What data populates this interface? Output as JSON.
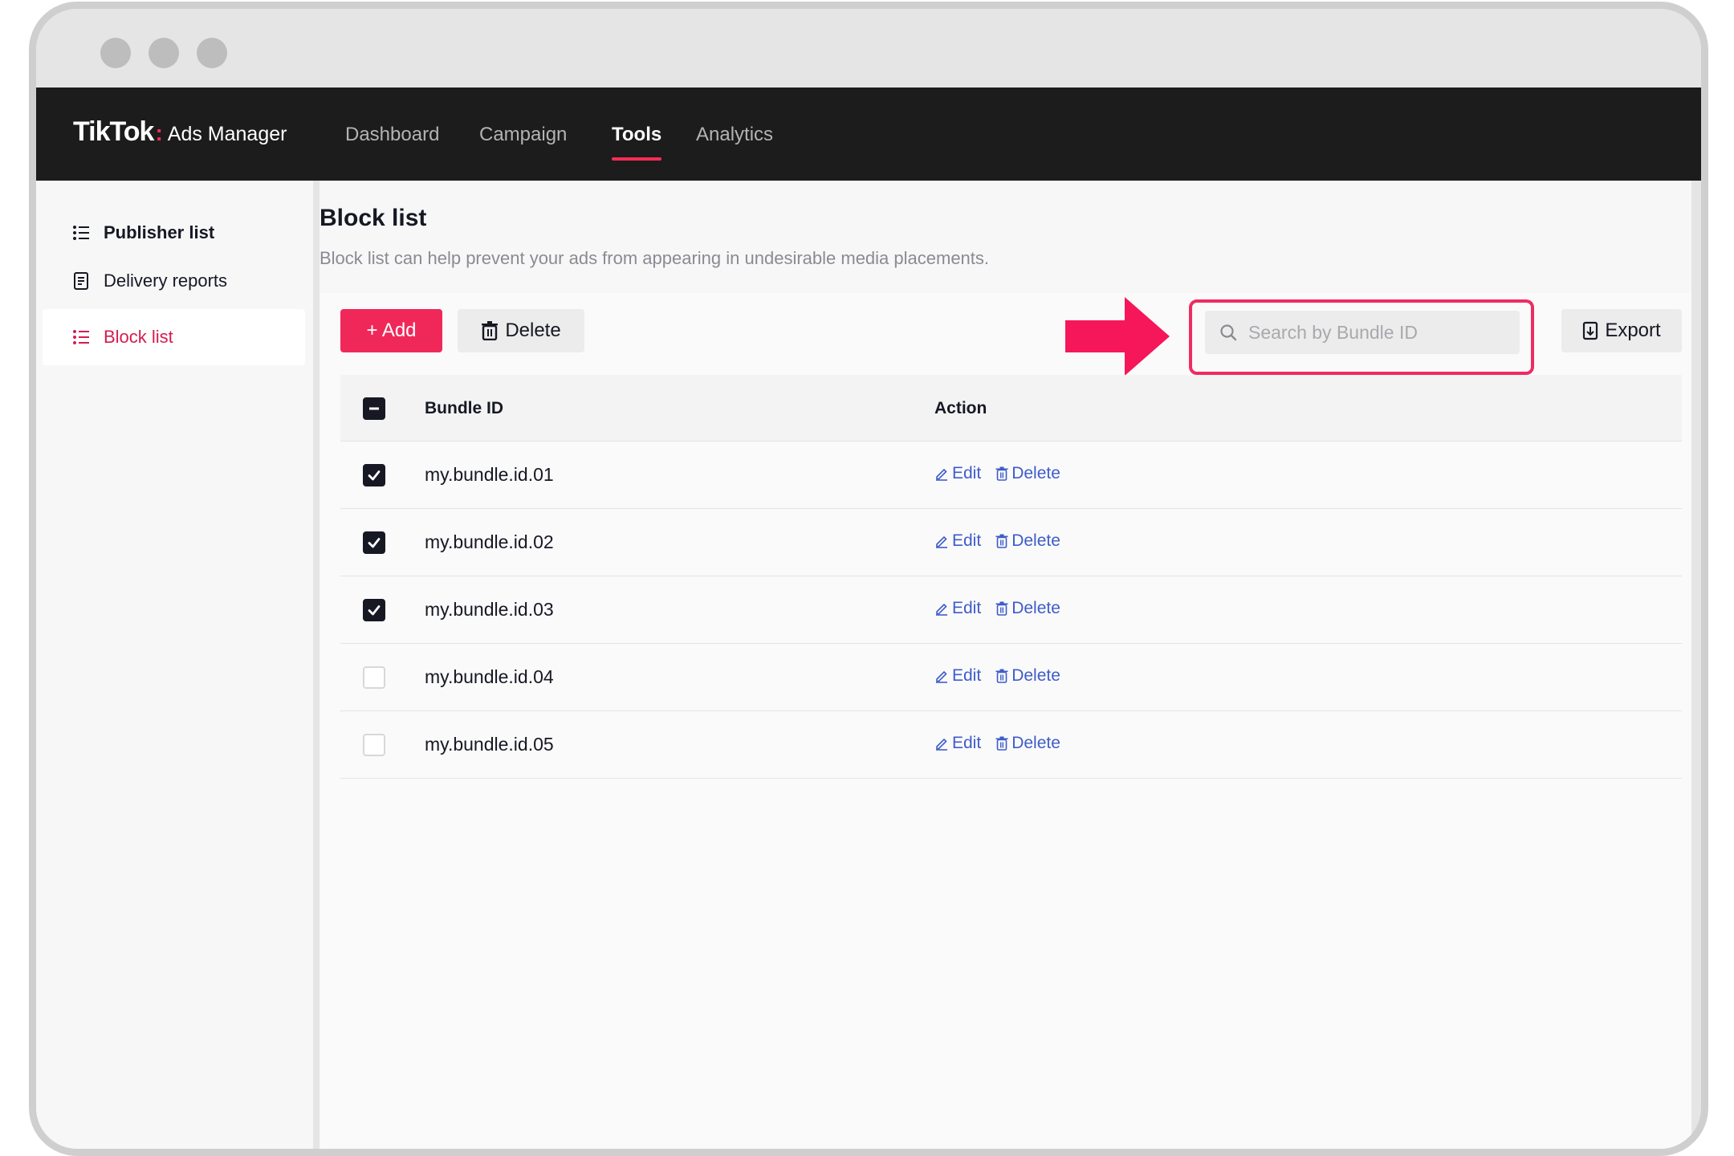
{
  "brand": {
    "logo": "TikTok",
    "colon": ":",
    "sub": "Ads Manager"
  },
  "nav": {
    "items": [
      {
        "label": "Dashboard",
        "active": false
      },
      {
        "label": "Campaign",
        "active": false
      },
      {
        "label": "Tools",
        "active": true
      },
      {
        "label": "Analytics",
        "active": false
      }
    ]
  },
  "sidebar": {
    "items": [
      {
        "label": "Publisher list",
        "icon": "list-icon",
        "active": false
      },
      {
        "label": "Delivery reports",
        "icon": "report-icon",
        "active": false
      },
      {
        "label": "Block list",
        "icon": "list-icon",
        "active": true
      }
    ]
  },
  "page": {
    "title": "Block list",
    "description": "Block list can help prevent your ads from appearing in undesirable media placements."
  },
  "toolbar": {
    "add_label": "+ Add",
    "delete_label": "Delete",
    "export_label": "Export",
    "search_placeholder": "Search by Bundle ID",
    "search_value": ""
  },
  "table": {
    "columns": [
      "Bundle ID",
      "Action"
    ],
    "header_checkbox": "indeterminate",
    "rows": [
      {
        "bundle_id": "my.bundle.id.01",
        "checked": true
      },
      {
        "bundle_id": "my.bundle.id.02",
        "checked": true
      },
      {
        "bundle_id": "my.bundle.id.03",
        "checked": true
      },
      {
        "bundle_id": "my.bundle.id.04",
        "checked": false
      },
      {
        "bundle_id": "my.bundle.id.05",
        "checked": false
      }
    ],
    "row_actions": {
      "edit": "Edit",
      "delete": "Delete"
    }
  },
  "colors": {
    "accent": "#fe2c55",
    "link": "#3e5cc9",
    "nav_bg": "#1c1c1c",
    "highlight": "#ef2c62"
  }
}
